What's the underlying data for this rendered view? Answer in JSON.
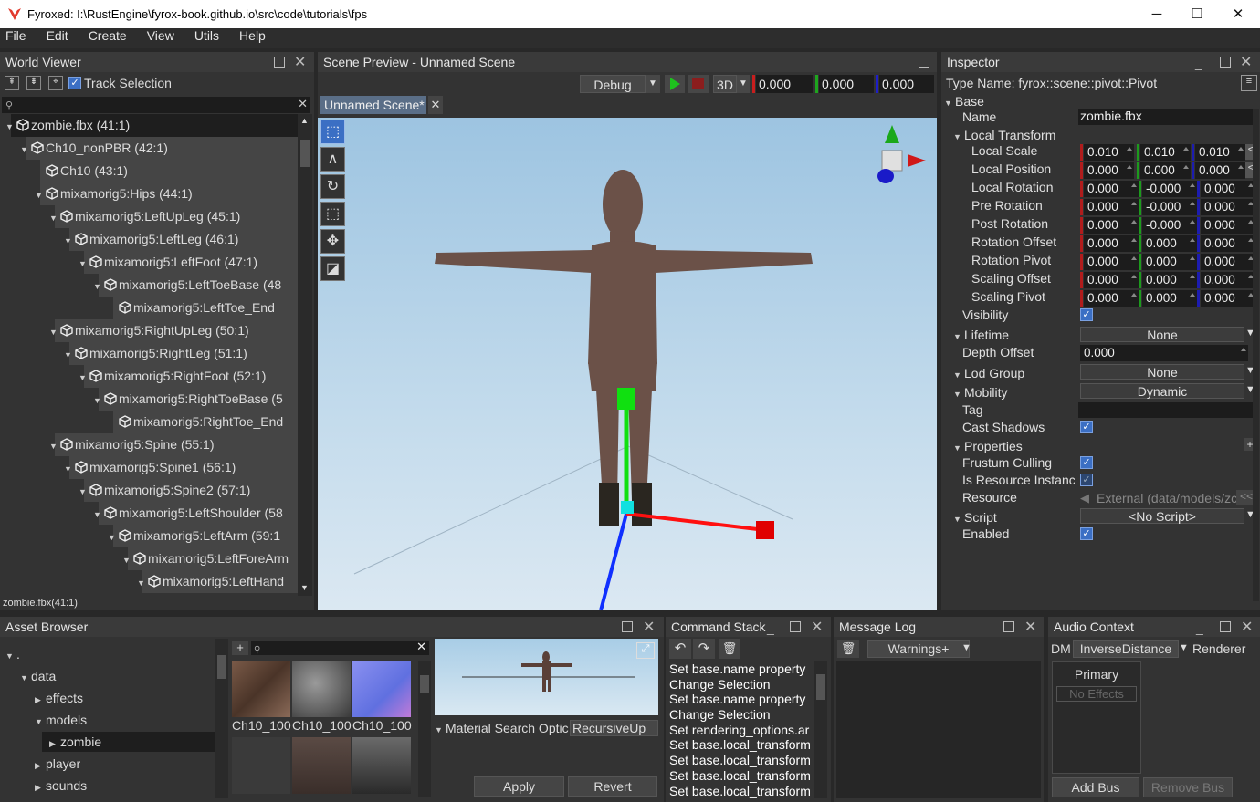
{
  "window": {
    "title": "Fyroxed: I:\\RustEngine\\fyrox-book.github.io\\src\\code\\tutorials\\fps",
    "min": "─",
    "max": "☐",
    "close": "✕"
  },
  "menu": [
    "File",
    "Edit",
    "Create",
    "View",
    "Utils",
    "Help"
  ],
  "world_viewer": {
    "title": "World Viewer",
    "track_selection": "Track Selection",
    "status": "zombie.fbx(41:1)",
    "nodes": [
      {
        "label": "zombie.fbx (41:1)",
        "depth": 0,
        "arrow": true,
        "sel": true
      },
      {
        "label": "Ch10_nonPBR (42:1)",
        "depth": 1,
        "arrow": true
      },
      {
        "label": "Ch10 (43:1)",
        "depth": 2,
        "arrow": false
      },
      {
        "label": "mixamorig5:Hips (44:1)",
        "depth": 2,
        "arrow": true
      },
      {
        "label": "mixamorig5:LeftUpLeg (45:1)",
        "depth": 3,
        "arrow": true
      },
      {
        "label": "mixamorig5:LeftLeg (46:1)",
        "depth": 4,
        "arrow": true
      },
      {
        "label": "mixamorig5:LeftFoot (47:1)",
        "depth": 5,
        "arrow": true
      },
      {
        "label": "mixamorig5:LeftToeBase (48",
        "depth": 6,
        "arrow": true
      },
      {
        "label": "mixamorig5:LeftToe_End",
        "depth": 7,
        "arrow": false
      },
      {
        "label": "mixamorig5:RightUpLeg (50:1)",
        "depth": 3,
        "arrow": true
      },
      {
        "label": "mixamorig5:RightLeg (51:1)",
        "depth": 4,
        "arrow": true
      },
      {
        "label": "mixamorig5:RightFoot (52:1)",
        "depth": 5,
        "arrow": true
      },
      {
        "label": "mixamorig5:RightToeBase (5",
        "depth": 6,
        "arrow": true
      },
      {
        "label": "mixamorig5:RightToe_End",
        "depth": 7,
        "arrow": false
      },
      {
        "label": "mixamorig5:Spine (55:1)",
        "depth": 3,
        "arrow": true
      },
      {
        "label": "mixamorig5:Spine1 (56:1)",
        "depth": 4,
        "arrow": true
      },
      {
        "label": "mixamorig5:Spine2 (57:1)",
        "depth": 5,
        "arrow": true
      },
      {
        "label": "mixamorig5:LeftShoulder (58",
        "depth": 6,
        "arrow": true
      },
      {
        "label": "mixamorig5:LeftArm (59:1",
        "depth": 7,
        "arrow": true
      },
      {
        "label": "mixamorig5:LeftForeArm",
        "depth": 8,
        "arrow": true
      },
      {
        "label": "mixamorig5:LeftHand",
        "depth": 9,
        "arrow": true
      }
    ]
  },
  "scene": {
    "title": "Scene Preview - Unnamed Scene",
    "tab": "Unnamed Scene*",
    "mode": "Debug",
    "view": "3D",
    "x": "0.000",
    "y": "0.000",
    "z": "0.000"
  },
  "inspector": {
    "title": "Inspector",
    "type_name": "Type Name: fyrox::scene::pivot::Pivot",
    "base": "Base",
    "name_label": "Name",
    "name_value": "zombie.fbx",
    "local_transform": "Local Transform",
    "vec_rows": [
      {
        "label": "Local Scale",
        "v": [
          "0.010",
          "0.010",
          "0.010"
        ],
        "reset": true
      },
      {
        "label": "Local Position",
        "v": [
          "0.000",
          "0.000",
          "0.000"
        ],
        "reset": true
      },
      {
        "label": "Local Rotation",
        "v": [
          "0.000",
          "-0.000",
          "0.000"
        ]
      },
      {
        "label": "Pre Rotation",
        "v": [
          "0.000",
          "-0.000",
          "0.000"
        ]
      },
      {
        "label": "Post Rotation",
        "v": [
          "0.000",
          "-0.000",
          "0.000"
        ]
      },
      {
        "label": "Rotation Offset",
        "v": [
          "0.000",
          "0.000",
          "0.000"
        ]
      },
      {
        "label": "Rotation Pivot",
        "v": [
          "0.000",
          "0.000",
          "0.000"
        ]
      },
      {
        "label": "Scaling Offset",
        "v": [
          "0.000",
          "0.000",
          "0.000"
        ]
      },
      {
        "label": "Scaling Pivot",
        "v": [
          "0.000",
          "0.000",
          "0.000"
        ]
      }
    ],
    "visibility": "Visibility",
    "lifetime": "Lifetime",
    "lifetime_value": "None",
    "depth_offset": "Depth Offset",
    "depth_offset_value": "0.000",
    "lod_group": "Lod Group",
    "lod_value": "None",
    "mobility": "Mobility",
    "mobility_value": "Dynamic",
    "tag": "Tag",
    "cast_shadows": "Cast Shadows",
    "properties": "Properties",
    "frustum_culling": "Frustum Culling",
    "is_resource_instance": "Is Resource Instanc",
    "resource": "Resource",
    "resource_value": "External (data/models/zc",
    "script": "Script",
    "script_value": "<No Script>",
    "enabled": "Enabled"
  },
  "asset_browser": {
    "title": "Asset Browser",
    "tree": [
      {
        "label": ".",
        "depth": 0,
        "arrow": "▼"
      },
      {
        "label": "data",
        "depth": 1,
        "arrow": "▼"
      },
      {
        "label": "effects",
        "depth": 2,
        "arrow": "▶"
      },
      {
        "label": "models",
        "depth": 2,
        "arrow": "▼"
      },
      {
        "label": "zombie",
        "depth": 3,
        "arrow": "▶",
        "sel": true
      },
      {
        "label": "player",
        "depth": 2,
        "arrow": "▶"
      },
      {
        "label": "sounds",
        "depth": 2,
        "arrow": "▶"
      }
    ],
    "thumbs": [
      "Ch10_100",
      "Ch10_100",
      "Ch10_100"
    ],
    "material_search": "Material Search Optic",
    "material_search_value": "RecursiveUp",
    "apply": "Apply",
    "revert": "Revert"
  },
  "command_stack": {
    "title": "Command Stack",
    "items": [
      "Set base.name property",
      "Change Selection",
      "Set base.name property",
      "Change Selection",
      "Set rendering_options.ar",
      "Set base.local_transform",
      "Set base.local_transform",
      "Set base.local_transform",
      "Set base.local_transform"
    ]
  },
  "message_log": {
    "title": "Message Log",
    "filter": "Warnings+"
  },
  "audio": {
    "title": "Audio Context",
    "dm": "DM",
    "dm_value": "InverseDistance",
    "renderer": "Renderer",
    "primary": "Primary",
    "no_effects": "No Effects",
    "add_bus": "Add Bus",
    "remove_bus": "Remove Bus"
  },
  "colors": {
    "accent": "#3b6fc4",
    "sky_top": "#9ec6e2",
    "sky_bottom": "#dbe9f3"
  }
}
